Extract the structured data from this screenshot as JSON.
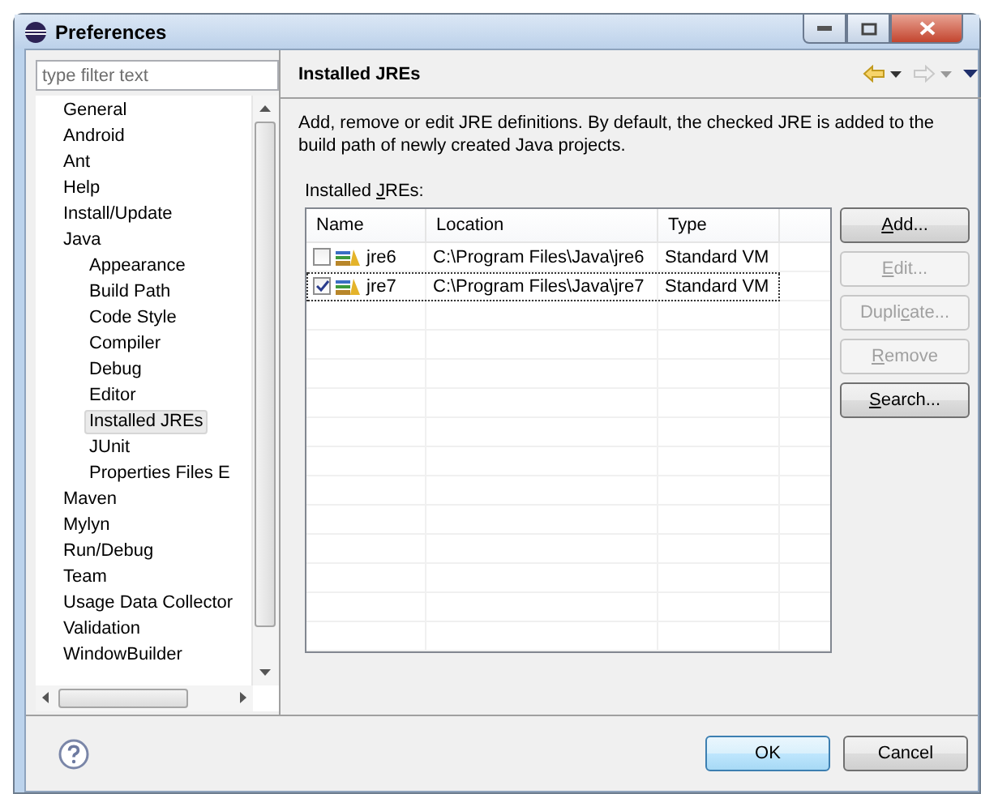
{
  "window": {
    "title": "Preferences"
  },
  "filter": {
    "placeholder": "type filter text"
  },
  "tree": [
    {
      "label": "General",
      "selected": false
    },
    {
      "label": "Android",
      "selected": false
    },
    {
      "label": "Ant",
      "selected": false
    },
    {
      "label": "Help",
      "selected": false
    },
    {
      "label": "Install/Update",
      "selected": false
    },
    {
      "label": "Java",
      "selected": false,
      "children": [
        {
          "label": "Appearance",
          "selected": false
        },
        {
          "label": "Build Path",
          "selected": false
        },
        {
          "label": "Code Style",
          "selected": false
        },
        {
          "label": "Compiler",
          "selected": false
        },
        {
          "label": "Debug",
          "selected": false
        },
        {
          "label": "Editor",
          "selected": false
        },
        {
          "label": "Installed JREs",
          "selected": true
        },
        {
          "label": "JUnit",
          "selected": false
        },
        {
          "label": "Properties Files E",
          "selected": false
        }
      ]
    },
    {
      "label": "Maven",
      "selected": false
    },
    {
      "label": "Mylyn",
      "selected": false
    },
    {
      "label": "Run/Debug",
      "selected": false
    },
    {
      "label": "Team",
      "selected": false
    },
    {
      "label": "Usage Data Collector",
      "selected": false
    },
    {
      "label": "Validation",
      "selected": false
    },
    {
      "label": "WindowBuilder",
      "selected": false
    }
  ],
  "page": {
    "title": "Installed JREs",
    "description": "Add, remove or edit JRE definitions. By default, the checked JRE is added to the build path of newly created Java projects.",
    "list_label": [
      {
        "text": "Installed ",
        "underlined": false
      },
      {
        "text": "J",
        "underlined": true
      },
      {
        "text": "REs:",
        "underlined": false
      }
    ]
  },
  "table": {
    "columns": [
      "Name",
      "Location",
      "Type"
    ],
    "rows": [
      {
        "name": "jre6",
        "location": "C:\\Program Files\\Java\\jre6",
        "type": "Standard VM",
        "checked": false,
        "selected": false
      },
      {
        "name": "jre7",
        "location": "C:\\Program Files\\Java\\jre7",
        "type": "Standard VM",
        "checked": true,
        "selected": true
      }
    ]
  },
  "buttons": [
    {
      "disabled": false,
      "label": [
        {
          "text": "A",
          "underlined": true
        },
        {
          "text": "dd...",
          "underlined": false
        }
      ]
    },
    {
      "disabled": true,
      "label": [
        {
          "text": "E",
          "underlined": true
        },
        {
          "text": "dit...",
          "underlined": false
        }
      ]
    },
    {
      "disabled": true,
      "label": [
        {
          "text": "Dupli",
          "underlined": false
        },
        {
          "text": "c",
          "underlined": true
        },
        {
          "text": "ate...",
          "underlined": false
        }
      ]
    },
    {
      "disabled": true,
      "label": [
        {
          "text": "R",
          "underlined": true
        },
        {
          "text": "emove",
          "underlined": false
        }
      ]
    },
    {
      "disabled": false,
      "label": [
        {
          "text": "S",
          "underlined": true
        },
        {
          "text": "earch...",
          "underlined": false
        }
      ]
    }
  ],
  "footer": {
    "ok": "OK",
    "cancel": "Cancel"
  }
}
